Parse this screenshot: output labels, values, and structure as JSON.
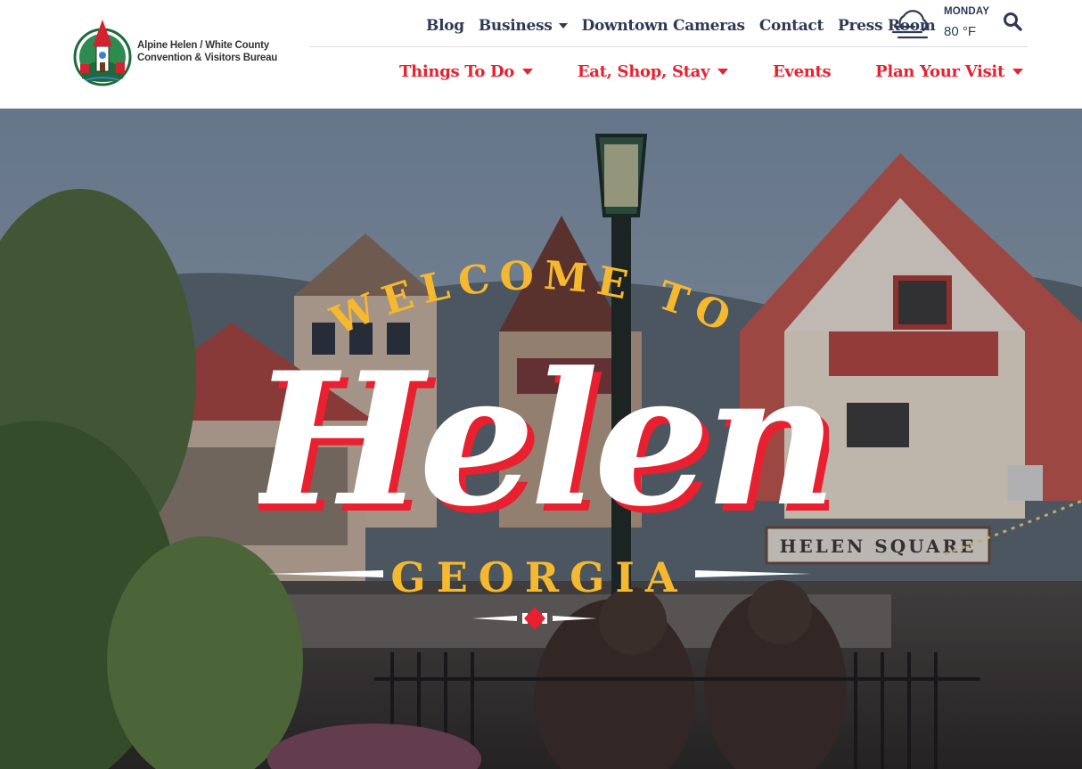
{
  "brand": {
    "logo_line1": "Alpine Helen / White County",
    "logo_line2": "Convention & Visitors Bureau"
  },
  "top_nav": {
    "items": [
      {
        "label": "Blog",
        "has_dropdown": false
      },
      {
        "label": "Business",
        "has_dropdown": true
      },
      {
        "label": "Downtown Cameras",
        "has_dropdown": false
      },
      {
        "label": "Contact",
        "has_dropdown": false
      },
      {
        "label": "Press Room",
        "has_dropdown": false
      }
    ]
  },
  "weather": {
    "icon": "fog-cloud-icon",
    "day": "MONDAY",
    "temp": "80 °F"
  },
  "search": {
    "icon": "search-icon"
  },
  "main_nav": {
    "items": [
      {
        "label": "Things To Do",
        "has_dropdown": true
      },
      {
        "label": "Eat, Shop, Stay",
        "has_dropdown": true
      },
      {
        "label": "Events",
        "has_dropdown": false
      },
      {
        "label": "Plan Your Visit",
        "has_dropdown": true
      }
    ]
  },
  "hero": {
    "welcome_text": "WELCOME TO",
    "title": "Helen",
    "subtitle": "GEORGIA",
    "sign_text": "HELEN SQUARE"
  },
  "colors": {
    "nav_dark": "#2e3a55",
    "nav_red": "#e8202f",
    "hero_gold": "#f5b82e",
    "hero_red": "#e8202f"
  }
}
